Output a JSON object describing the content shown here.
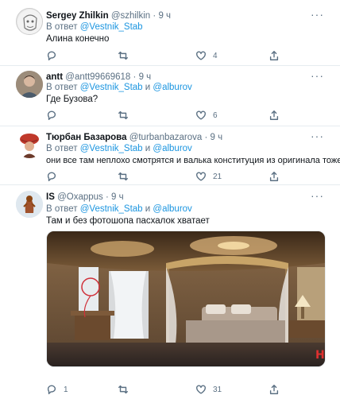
{
  "tweets": [
    {
      "name": "Sergey Zhilkin",
      "handle": "@szhilkin",
      "dot": "·",
      "time": "9 ч",
      "reply_prefix": "В ответ",
      "mention1": "@Vestnik_Stab",
      "text": "Алина конечно",
      "likes": "4"
    },
    {
      "name": "antt",
      "handle": "@antt99669618",
      "dot": "·",
      "time": "9 ч",
      "reply_prefix": "В ответ",
      "mention1": "@Vestnik_Stab",
      "conj": "и",
      "mention2": "@alburov",
      "text": "Где Бузова?",
      "likes": "6"
    },
    {
      "name": "Тюрбан Базарова",
      "handle": "@turbanbazarova",
      "dot": "·",
      "time": "9 ч",
      "reply_prefix": "В ответ",
      "mention1": "@Vestnik_Stab",
      "conj": "и",
      "mention2": "@alburov",
      "text": "они все там неплохо смотрятся и валька конституция из оригинала тоже!",
      "likes": "21"
    },
    {
      "name": "IS",
      "handle": "@Oxappus",
      "dot": "·",
      "time": "9 ч",
      "reply_prefix": "В ответ",
      "mention1": "@Vestnik_Stab",
      "conj": "и",
      "mention2": "@alburov",
      "text": "Там и без фотошопа пасхалок хватает",
      "replies": "1",
      "likes": "31",
      "photo_watermark": "Н"
    }
  ],
  "colors": {
    "accent": "#1b95e0",
    "muted": "#5b7083",
    "border": "#e6ecf0"
  }
}
